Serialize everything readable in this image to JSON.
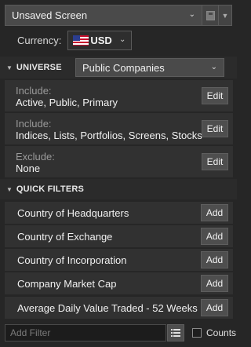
{
  "topbar": {
    "screen_name": "Unsaved Screen"
  },
  "currency": {
    "label": "Currency:",
    "value": "USD",
    "flag": "us-flag"
  },
  "universe": {
    "header": "UNIVERSE",
    "selected": "Public Companies"
  },
  "criteria": [
    {
      "label": "Include:",
      "value": "Active, Public, Primary",
      "button": "Edit"
    },
    {
      "label": "Include:",
      "value": "Indices, Lists, Portfolios, Screens, Stocks",
      "button": "Edit"
    },
    {
      "label": "Exclude:",
      "value": "None",
      "button": "Edit"
    }
  ],
  "quick_filters": {
    "header": "QUICK FILTERS",
    "items": [
      {
        "name": "Country of Headquarters",
        "button": "Add"
      },
      {
        "name": "Country of Exchange",
        "button": "Add"
      },
      {
        "name": "Country of Incorporation",
        "button": "Add"
      },
      {
        "name": "Company Market Cap",
        "button": "Add"
      },
      {
        "name": "Average Daily Value Traded - 52 Weeks",
        "button": "Add"
      }
    ]
  },
  "bottom": {
    "add_filter_placeholder": "Add Filter",
    "counts_label": "Counts",
    "counts_checked": false
  },
  "colors": {
    "background": "#262626",
    "row_background": "#313131",
    "button": "#4e4e4e"
  }
}
